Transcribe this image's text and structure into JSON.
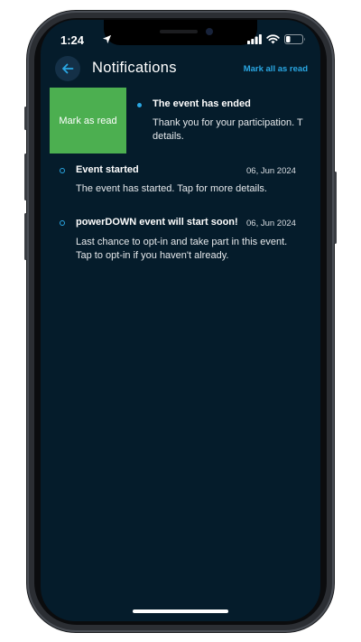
{
  "status_bar": {
    "time": "1:24"
  },
  "header": {
    "title": "Notifications",
    "mark_all": "Mark all as read"
  },
  "swipe_action": {
    "label": "Mark as read"
  },
  "notifications": [
    {
      "title": "The event has ended",
      "date": "",
      "body": "Thank you for your participation. T details.",
      "state": "unread",
      "swiped": true
    },
    {
      "title": "Event started",
      "date": "06, Jun 2024",
      "body": "The event has started. Tap for more details.",
      "state": "read"
    },
    {
      "title": "powerDOWN event will start soon!",
      "date": "06, Jun 2024",
      "body": "Last chance to opt-in and take part in this event. Tap to opt-in if you haven't already.",
      "state": "read"
    }
  ],
  "colors": {
    "background": "#051c2b",
    "accent": "#2aa7e3",
    "swipe_green": "#4caf50"
  }
}
